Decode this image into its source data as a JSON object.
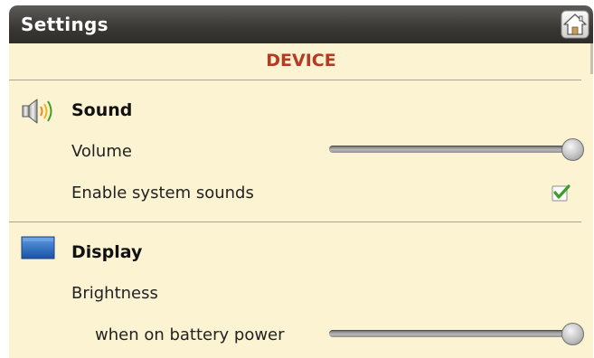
{
  "window": {
    "title": "Settings",
    "home_icon": "home-icon"
  },
  "section": {
    "title": "DEVICE"
  },
  "sound": {
    "icon": "speaker-icon",
    "title": "Sound",
    "volume": {
      "label": "Volume",
      "value": 1.0
    },
    "system_sounds": {
      "label": "Enable system sounds",
      "checked": true
    }
  },
  "display": {
    "icon": "display-icon",
    "title": "Display",
    "brightness": {
      "label": "Brightness"
    },
    "battery": {
      "label": "when on battery power",
      "value": 1.0
    }
  },
  "colors": {
    "section_header": "#b53a22",
    "background": "#fcf3d3",
    "titlebar": "#3a3835",
    "check": "#3d9c2a"
  }
}
